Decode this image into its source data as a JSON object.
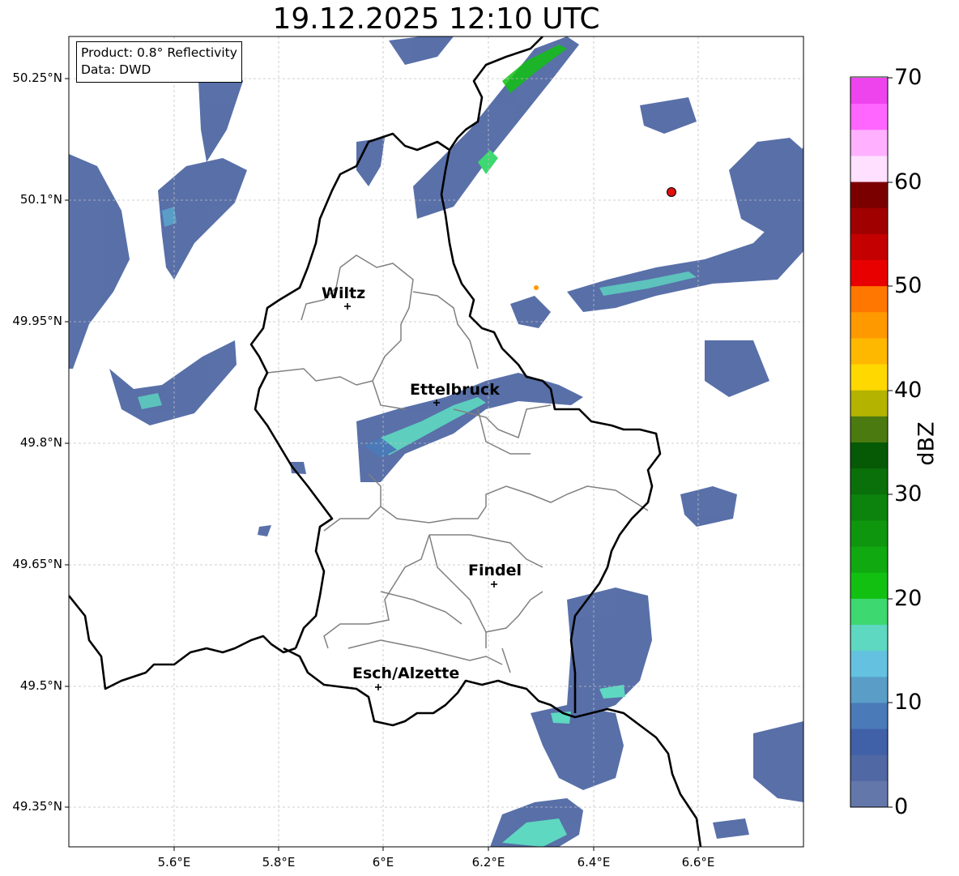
{
  "title": "19.12.2025 12:10 UTC",
  "info": {
    "line1": "Product: 0.8° Reflectivity",
    "line2": "Data: DWD"
  },
  "y_ticks": [
    "50.25°N",
    "50.1°N",
    "49.95°N",
    "49.8°N",
    "49.65°N",
    "49.5°N",
    "49.35°N"
  ],
  "x_ticks": [
    "5.6°E",
    "5.8°E",
    "6°E",
    "6.2°E",
    "6.4°E",
    "6.6°E"
  ],
  "cities": [
    {
      "name": "Wiltz"
    },
    {
      "name": "Ettelbruck"
    },
    {
      "name": "Findel"
    },
    {
      "name": "Esch/Alzette"
    }
  ],
  "colorbar": {
    "label": "dBZ",
    "ticks": [
      "70",
      "60",
      "50",
      "40",
      "30",
      "20",
      "10",
      "0"
    ],
    "colors": [
      "#ee44ee",
      "#ff66ff",
      "#ffb0ff",
      "#ffe0ff",
      "#7a0000",
      "#a00000",
      "#c40000",
      "#e80000",
      "#ff7700",
      "#ff9900",
      "#ffb800",
      "#ffd800",
      "#b3b300",
      "#4a7a10",
      "#065a06",
      "#0a700a",
      "#0c830c",
      "#0e960e",
      "#10a910",
      "#12c012",
      "#3dd870",
      "#5ed8c0",
      "#64c2e0",
      "#5a9ec8",
      "#4a7ab8",
      "#4060a8",
      "#5068a4",
      "#6477aa"
    ]
  },
  "map_colors": {
    "echo_light": "#5068a4",
    "echo_mid": "#4a7ab8",
    "echo_cyan": "#5ed8c0",
    "echo_green": "#12c012",
    "border": "#000000",
    "canton": "#808080",
    "grid": "#c0c0c0"
  }
}
